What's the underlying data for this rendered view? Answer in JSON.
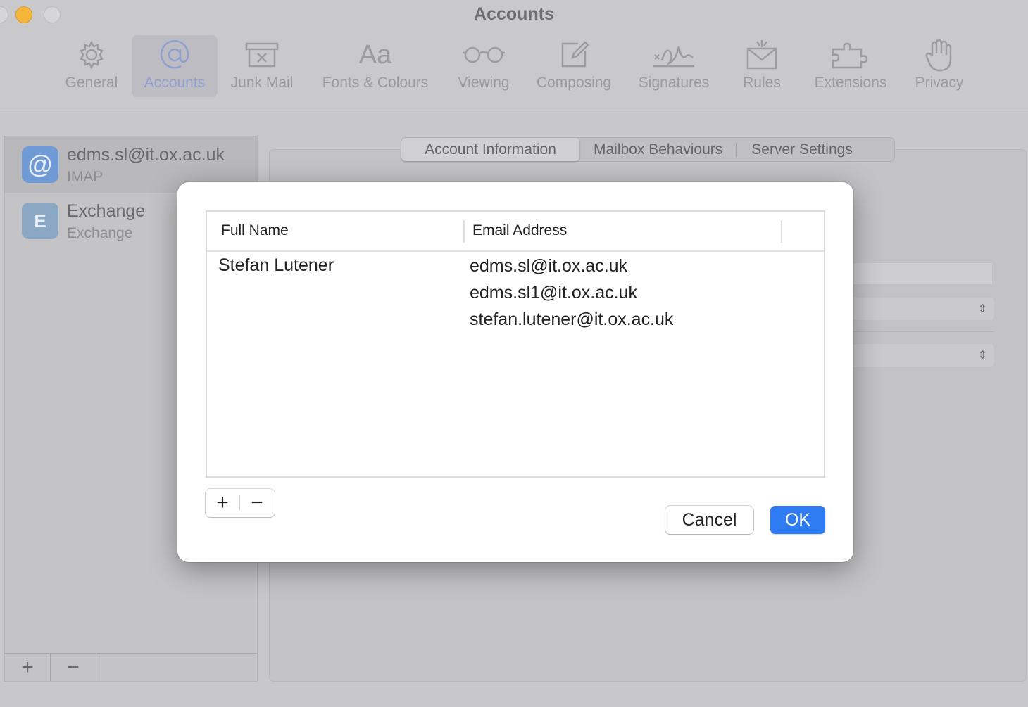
{
  "window": {
    "title": "Accounts"
  },
  "toolbar": [
    {
      "label": "General",
      "icon": "gear-icon"
    },
    {
      "label": "Accounts",
      "icon": "at-icon",
      "active": true
    },
    {
      "label": "Junk Mail",
      "icon": "junk-mail-icon"
    },
    {
      "label": "Fonts & Colours",
      "icon": "fonts-icon"
    },
    {
      "label": "Viewing",
      "icon": "glasses-icon"
    },
    {
      "label": "Composing",
      "icon": "compose-icon"
    },
    {
      "label": "Signatures",
      "icon": "signature-icon"
    },
    {
      "label": "Rules",
      "icon": "rules-envelope-icon"
    },
    {
      "label": "Extensions",
      "icon": "puzzle-icon"
    },
    {
      "label": "Privacy",
      "icon": "hand-icon"
    }
  ],
  "sidebar": {
    "accounts": [
      {
        "name": "edms.sl@it.ox.ac.uk",
        "type": "IMAP",
        "selected": true
      },
      {
        "name": "Exchange",
        "type": "Exchange",
        "selected": false
      }
    ],
    "add_label": "+",
    "remove_label": "−"
  },
  "tabs": [
    {
      "label": "Account Information",
      "active": true
    },
    {
      "label": "Mailbox Behaviours",
      "active": false
    },
    {
      "label": "Server Settings",
      "active": false
    }
  ],
  "dialog": {
    "columns": {
      "full_name": "Full Name",
      "email": "Email Address"
    },
    "rows": [
      {
        "full_name": "Stefan Lutener",
        "emails": [
          "edms.sl@it.ox.ac.uk",
          "edms.sl1@it.ox.ac.uk",
          "stefan.lutener@it.ox.ac.uk"
        ]
      }
    ],
    "add_label": "+",
    "remove_label": "−",
    "cancel_label": "Cancel",
    "ok_label": "OK"
  },
  "colors": {
    "accent": "#2f7bf2",
    "traffic_minimize": "#f3b53a"
  }
}
